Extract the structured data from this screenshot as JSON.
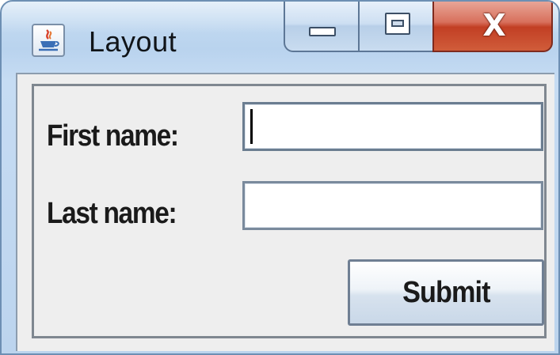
{
  "window": {
    "title": "Layout",
    "app_icon": "java-cup-icon",
    "caption_buttons": {
      "minimize_icon": "minimize-icon",
      "maximize_icon": "maximize-icon",
      "close_icon": "close-icon",
      "close_glyph": "X"
    }
  },
  "form": {
    "first_name_label": "First name:",
    "first_name_value": "",
    "last_name_label": "Last name:",
    "last_name_value": "",
    "submit_label": "Submit"
  },
  "colors": {
    "close_button": "#c94a2e",
    "frame": "#bcd4ee",
    "client_background": "#eeeeee"
  }
}
